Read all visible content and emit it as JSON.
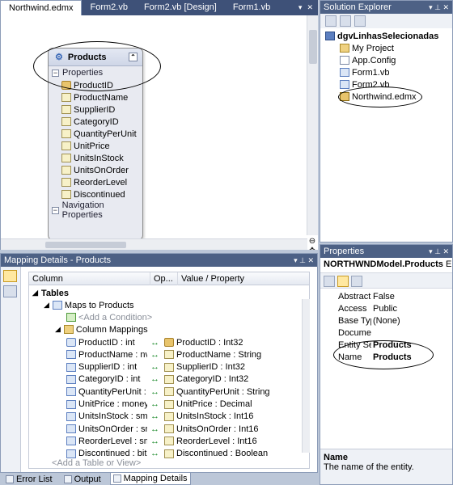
{
  "tabs": [
    "Northwind.edmx",
    "Form2.vb",
    "Form2.vb [Design]",
    "Form1.vb"
  ],
  "designer": {
    "entity_title": "Products",
    "properties_label": "Properties",
    "properties": [
      "ProductID",
      "ProductName",
      "SupplierID",
      "CategoryID",
      "QuantityPerUnit",
      "UnitPrice",
      "UnitsInStock",
      "UnitsOnOrder",
      "ReorderLevel",
      "Discontinued"
    ],
    "nav_label": "Navigation Properties"
  },
  "solution_explorer": {
    "title": "Solution Explorer",
    "project": "dgvLinhasSelecionadas",
    "items": [
      "My Project",
      "App.Config",
      "Form1.vb",
      "Form2.vb",
      "Northwind.edmx"
    ]
  },
  "mapping": {
    "title": "Mapping Details - Products",
    "col_column": "Column",
    "col_op": "Op...",
    "col_value": "Value / Property",
    "tables": "Tables",
    "maps_to": "Maps to Products",
    "add_condition": "<Add a Condition>",
    "column_mappings": "Column Mappings",
    "rows": [
      {
        "col": "ProductID : int",
        "prop": "ProductID : Int32"
      },
      {
        "col": "ProductName : nv",
        "prop": "ProductName : String"
      },
      {
        "col": "SupplierID : int",
        "prop": "SupplierID : Int32"
      },
      {
        "col": "CategoryID : int",
        "prop": "CategoryID : Int32"
      },
      {
        "col": "QuantityPerUnit :",
        "prop": "QuantityPerUnit : String"
      },
      {
        "col": "UnitPrice : money",
        "prop": "UnitPrice : Decimal"
      },
      {
        "col": "UnitsInStock : sm",
        "prop": "UnitsInStock : Int16"
      },
      {
        "col": "UnitsOnOrder : sr",
        "prop": "UnitsOnOrder : Int16"
      },
      {
        "col": "ReorderLevel : sm",
        "prop": "ReorderLevel : Int16"
      },
      {
        "col": "Discontinued : bit",
        "prop": "Discontinued : Boolean"
      }
    ],
    "add_table": "<Add a Table or View>"
  },
  "properties": {
    "title": "Properties",
    "object": "NORTHWNDModel.Products",
    "object_type": "Enti",
    "rows": [
      {
        "k": "Abstract",
        "v": "False"
      },
      {
        "k": "Access",
        "v": "Public"
      },
      {
        "k": "Base Type",
        "v": "(None)"
      },
      {
        "k": "Documentatio",
        "v": ""
      },
      {
        "k": "Entity Set Nar",
        "v": "Products"
      },
      {
        "k": "Name",
        "v": "Products"
      }
    ],
    "desc_title": "Name",
    "desc_text": "The name of the entity."
  },
  "bottom_tabs": [
    "Error List",
    "Output",
    "Mapping Details"
  ]
}
